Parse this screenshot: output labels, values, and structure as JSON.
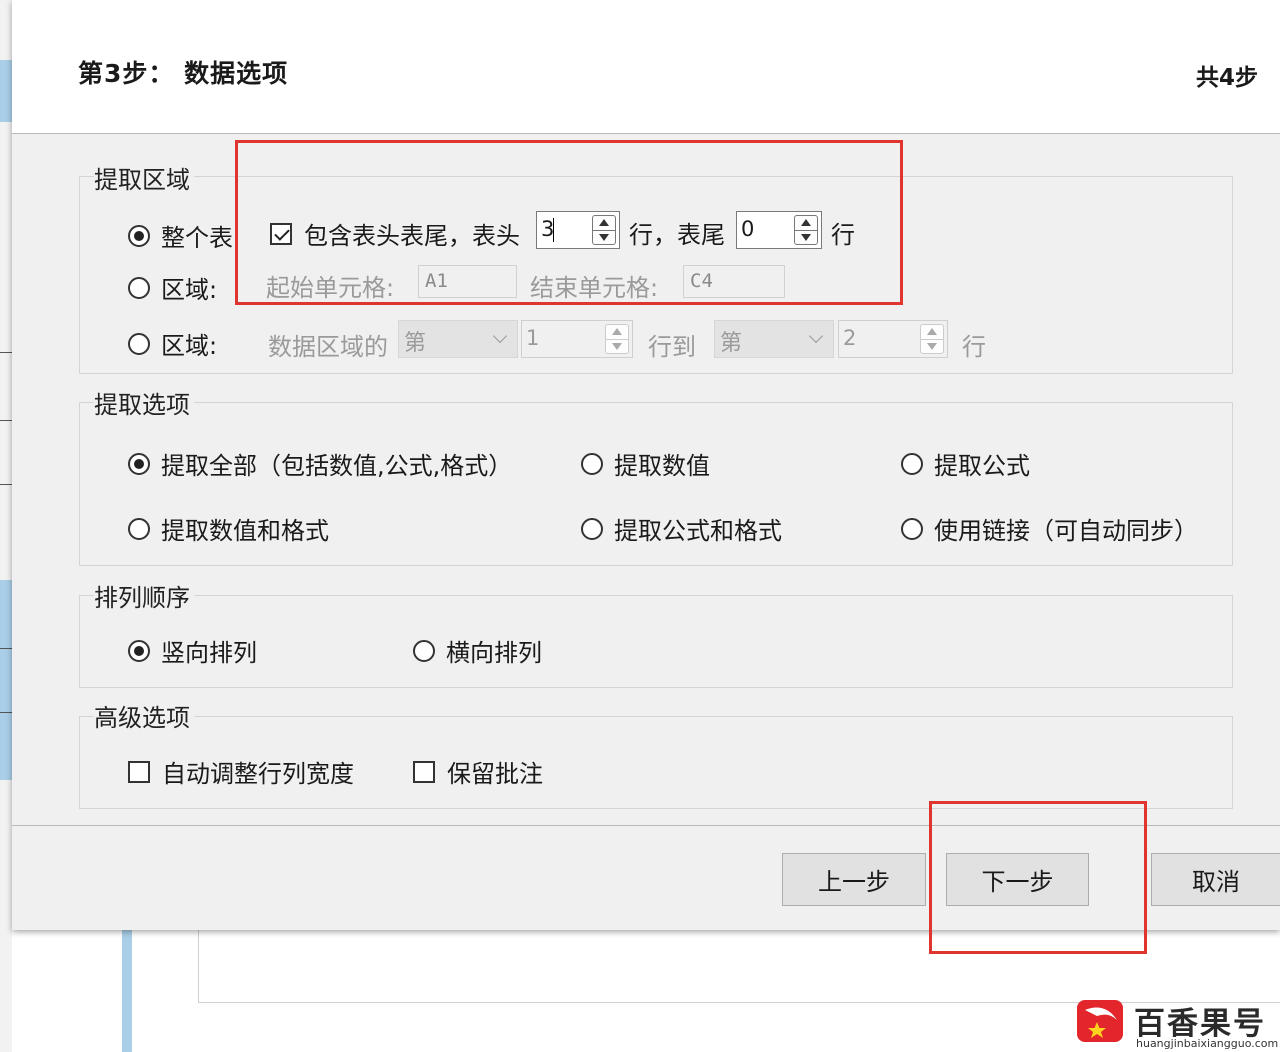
{
  "dialog": {
    "step_title": "第3步： 数据选项",
    "step_count": "共4步"
  },
  "extract_area": {
    "group_label": "提取区域",
    "whole_table_label": "整个表",
    "include_header_footer_label": "包含表头表尾，表头",
    "header_rows_value": "3",
    "rows_footer_label": "行，表尾",
    "footer_rows_value": "0",
    "rows_unit": "行",
    "range_label": "区域:",
    "start_cell_label": "起始单元格:",
    "start_cell_value": "A1",
    "end_cell_label": "结束单元格:",
    "end_cell_value": "C4",
    "range2_label": "区域:",
    "data_area_label": "数据区域的",
    "from_select": "第",
    "from_value": "1",
    "to_label": "行到",
    "to_select": "第",
    "to_value": "2",
    "row_label": "行"
  },
  "extract_options": {
    "group_label": "提取选项",
    "extract_all": "提取全部（包括数值,公式,格式）",
    "extract_values": "提取数值",
    "extract_formulas": "提取公式",
    "extract_values_formats": "提取数值和格式",
    "extract_formulas_formats": "提取公式和格式",
    "use_links": "使用链接（可自动同步）"
  },
  "sort_order": {
    "group_label": "排列顺序",
    "vertical": "竖向排列",
    "horizontal": "横向排列"
  },
  "advanced": {
    "group_label": "高级选项",
    "auto_adjust": "自动调整行列宽度",
    "keep_comments": "保留批注"
  },
  "buttons": {
    "prev": "上一步",
    "next": "下一步",
    "cancel": "取消"
  },
  "watermark": {
    "name": "百香果号",
    "url": "huangjinbaixiangguo.com"
  },
  "colors": {
    "highlight": "#e0342f",
    "dialog_bg": "#f0f0f0"
  }
}
